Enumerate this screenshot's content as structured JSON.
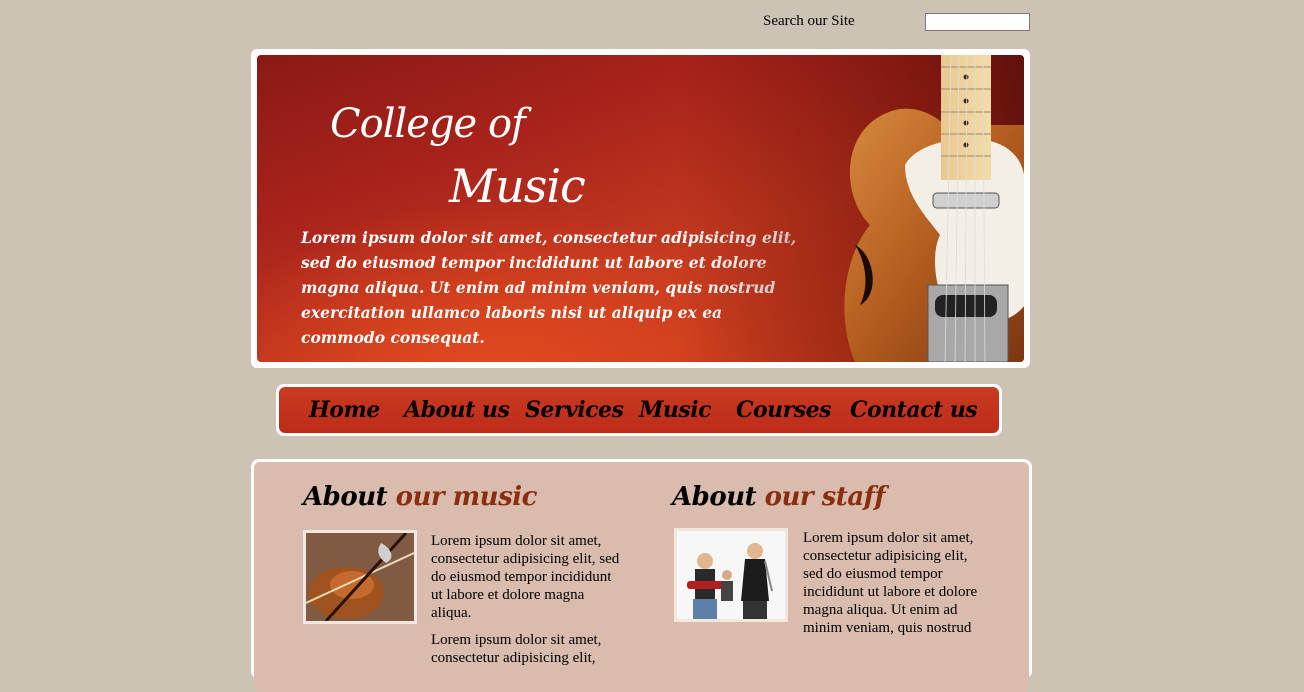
{
  "search": {
    "label": "Search our Site",
    "value": ""
  },
  "banner": {
    "title_line1": "College of",
    "title_line2": "Music",
    "text": "Lorem ipsum dolor sit amet, consectetur adipisicing elit, sed do eiusmod tempor incididunt ut labore et dolore magna aliqua. Ut enim ad minim veniam, quis nostrud exercitation ullamco laboris nisi ut aliquip ex ea commodo consequat."
  },
  "nav": {
    "items": [
      {
        "label": "Home"
      },
      {
        "label": "About us"
      },
      {
        "label": "Services"
      },
      {
        "label": "Music"
      },
      {
        "label": "Courses"
      },
      {
        "label": "Contact us"
      }
    ]
  },
  "about_music": {
    "title_black": "About",
    "title_accent": "our music",
    "para1": "Lorem ipsum dolor sit amet, consectetur adipisicing elit, sed do eiusmod tempor incididunt ut labore et dolore magna aliqua.",
    "para2": "Lorem ipsum dolor sit amet, consectetur adipisicing elit,"
  },
  "about_staff": {
    "title_black": "About",
    "title_accent": "our staff",
    "para1": "Lorem ipsum dolor sit amet, consectetur adipisicing elit, sed do eiusmod tempor incididunt ut labore et dolore magna aliqua. Ut enim ad minim veniam, quis nostrud"
  },
  "colors": {
    "page_bg": "#cdc3b4",
    "nav_red": "#c0311b",
    "accent_brown": "#8b2e10",
    "content_bg": "#d9bcad"
  }
}
